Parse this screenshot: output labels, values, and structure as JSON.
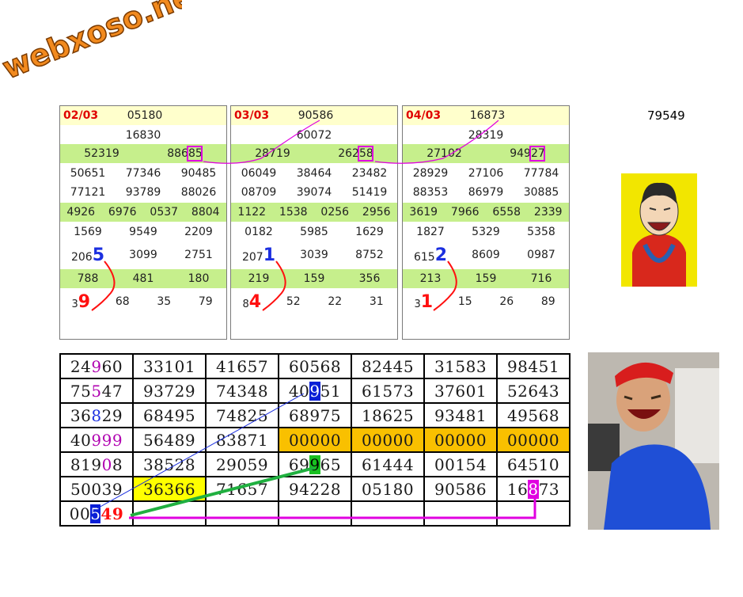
{
  "logo_text": "webxoso.net",
  "top_right_number": "79549",
  "panels": [
    {
      "date": "02/03",
      "special": "05180",
      "first": "16830",
      "second": [
        "52319",
        "88685"
      ],
      "third": [
        "50651",
        "77346",
        "90485",
        "77121",
        "93789",
        "88026"
      ],
      "fourth": [
        "4926",
        "6976",
        "0537",
        "8804"
      ],
      "fifth": [
        "1569",
        "9549",
        "2209"
      ],
      "sixth": {
        "prefix": "206",
        "big": "5",
        "rest": [
          "3099",
          "2751"
        ]
      },
      "seventh": [
        "788",
        "481",
        "180"
      ],
      "eighth": {
        "prefix": "3",
        "big": "9",
        "rest": [
          "68",
          "35",
          "79"
        ]
      }
    },
    {
      "date": "03/03",
      "special": "90586",
      "first": "60072",
      "second": [
        "28719",
        "26258"
      ],
      "third": [
        "06049",
        "38464",
        "23482",
        "08709",
        "39074",
        "51419"
      ],
      "fourth": [
        "1122",
        "1538",
        "0256",
        "2956"
      ],
      "fifth": [
        "0182",
        "5985",
        "1629"
      ],
      "sixth": {
        "prefix": "207",
        "big": "1",
        "rest": [
          "3039",
          "8752"
        ]
      },
      "seventh": [
        "219",
        "159",
        "356"
      ],
      "eighth": {
        "prefix": "8",
        "big": "4",
        "rest": [
          "52",
          "22",
          "31"
        ]
      }
    },
    {
      "date": "04/03",
      "special": "16873",
      "first": "28319",
      "second": [
        "27102",
        "94927"
      ],
      "third": [
        "28929",
        "27106",
        "77784",
        "88353",
        "86979",
        "30885"
      ],
      "fourth": [
        "3619",
        "7966",
        "6558",
        "2339"
      ],
      "fifth": [
        "1827",
        "5329",
        "5358"
      ],
      "sixth": {
        "prefix": "615",
        "big": "2",
        "rest": [
          "8609",
          "0987"
        ]
      },
      "seventh": [
        "213",
        "159",
        "716"
      ],
      "eighth": {
        "prefix": "3",
        "big": "1",
        "rest": [
          "15",
          "26",
          "89"
        ]
      }
    }
  ],
  "grid": {
    "rows": [
      [
        "24960",
        "33101",
        "41657",
        "60568",
        "82445",
        "31583",
        "98451"
      ],
      [
        "75547",
        "93729",
        "74348",
        "40951",
        "61573",
        "37601",
        "52643"
      ],
      [
        "36829",
        "68495",
        "74825",
        "68975",
        "18625",
        "93481",
        "49568"
      ],
      [
        "40999",
        "56489",
        "83871",
        "00000",
        "00000",
        "00000",
        "00000"
      ],
      [
        "81908",
        "38528",
        "29059",
        "69965",
        "61444",
        "00154",
        "64510"
      ],
      [
        "50039",
        "36366",
        "71657",
        "94228",
        "05180",
        "90586",
        "16873"
      ],
      [
        "00549",
        "",
        "",
        "",
        "",
        "",
        ""
      ]
    ]
  },
  "colors": {
    "panel_header": "#ffffcc",
    "panel_green_row": "#c6ef8c",
    "grid_orange": "#f9c000",
    "grid_yellow": "#ffff00",
    "line_magenta": "#e000e0",
    "line_green": "#20b040",
    "line_blue": "#1b2fe0"
  }
}
